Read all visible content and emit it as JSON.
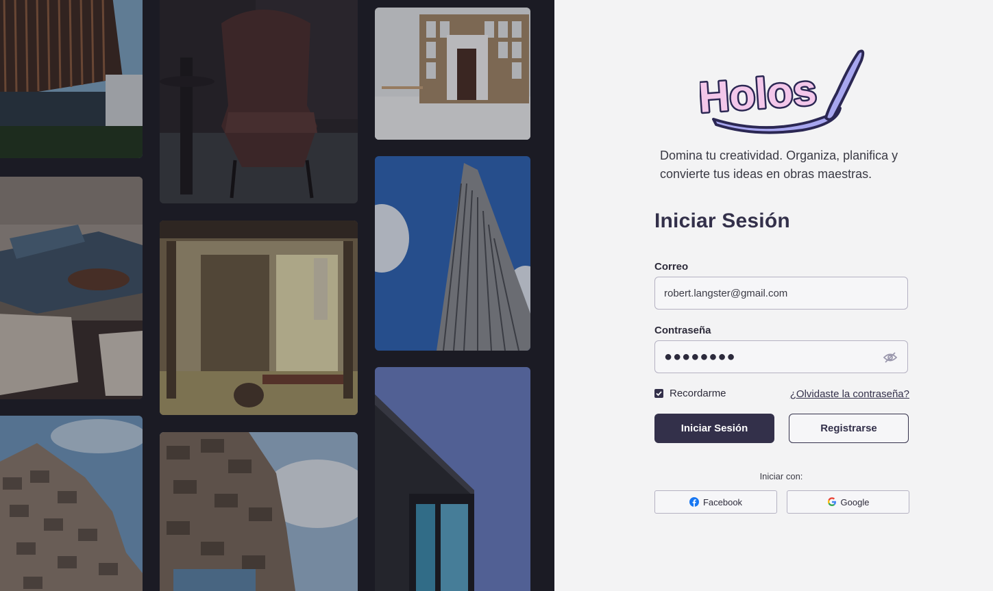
{
  "brand": {
    "logo_text": "Holos"
  },
  "tagline": "Domina tu creatividad. Organiza, planifica y convierte tus ideas en obras maestras.",
  "login": {
    "title": "Iniciar Sesión",
    "email_label": "Correo",
    "email_value": "robert.langster@gmail.com",
    "password_label": "Contraseña",
    "password_value": "●●●●●●●●",
    "remember_label": "Recordarme",
    "remember_checked": true,
    "forgot_label": "¿Olvidaste la contraseña?",
    "submit_label": "Iniciar Sesión",
    "register_label": "Registrarse",
    "social_heading": "Iniciar con:",
    "facebook_label": "Facebook",
    "google_label": "Google"
  },
  "gallery": [
    "building-facade-photo",
    "leather-armchair-photo",
    "white-interior-photo",
    "outdoor-lounge-photo",
    "japanese-room-photo",
    "skyscraper-photo",
    "stacked-building-photo",
    "stacked-tower-photo",
    "dark-building-photo"
  ],
  "colors": {
    "primary": "#33304a",
    "panel_bg": "#f3f3f4",
    "gallery_bg": "#1b1b24",
    "logo_fill": "#f3c7ea",
    "logo_outline": "#2b2753",
    "logo_brush": "#a7a6ef"
  }
}
